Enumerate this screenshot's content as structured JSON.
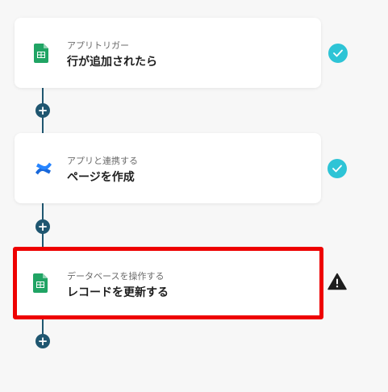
{
  "flow": {
    "steps": [
      {
        "subtitle": "アプリトリガー",
        "title": "行が追加されたら",
        "app_icon": "google-sheets-icon",
        "status": "check-icon"
      },
      {
        "subtitle": "アプリと連携する",
        "title": "ページを作成",
        "app_icon": "confluence-icon",
        "status": "check-icon"
      },
      {
        "subtitle": "データベースを操作する",
        "title": "レコードを更新する",
        "app_icon": "google-sheets-icon",
        "status": "warning-icon"
      }
    ],
    "add_label": "+"
  },
  "colors": {
    "connector": "#1f5670",
    "check": "#2ec4d6",
    "highlight": "#ee0000",
    "sheets_green": "#20a464"
  }
}
